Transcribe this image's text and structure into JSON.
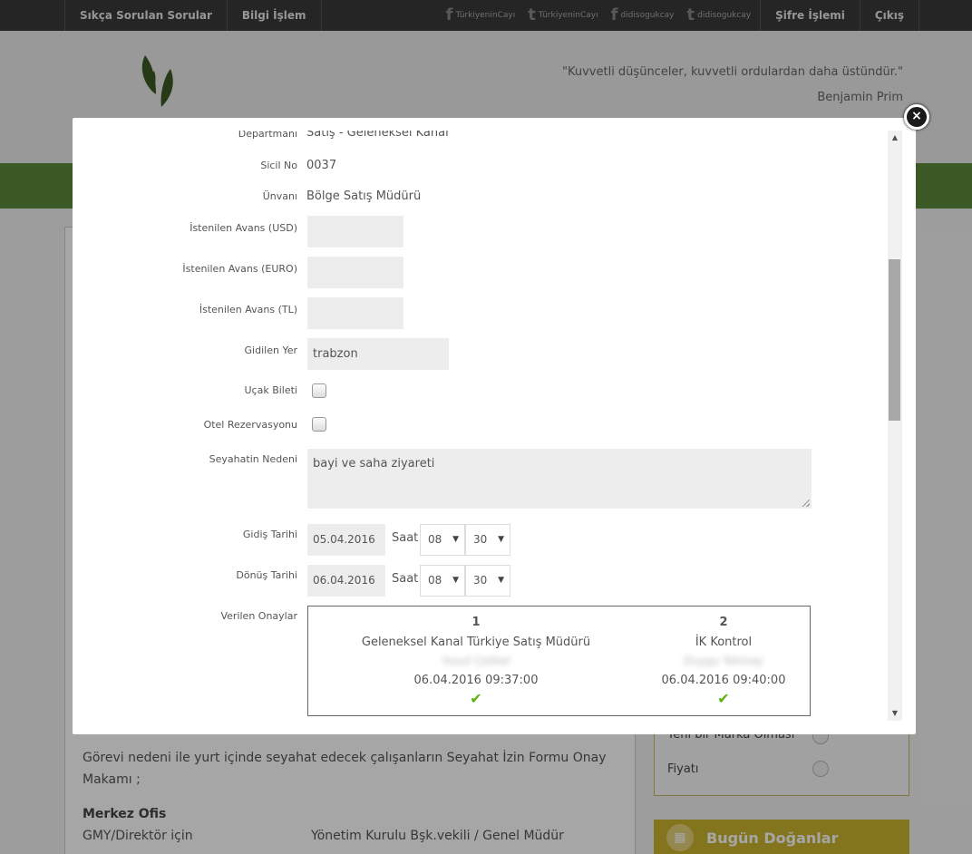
{
  "topbar": {
    "left_items": [
      "Sıkça Sorulan Sorular",
      "Bilgi İşlem"
    ],
    "social": [
      {
        "icon": "facebook-icon",
        "glyph": "f",
        "label": "TürkiyeninCayı"
      },
      {
        "icon": "twitter-icon",
        "glyph": "t",
        "label": "TürkiyeninCayı"
      },
      {
        "icon": "facebook-icon",
        "glyph": "f",
        "label": "didisogukcay"
      },
      {
        "icon": "twitter-icon",
        "glyph": "t",
        "label": "didisogukcay"
      }
    ],
    "right_items": [
      "Şifre İşlemi",
      "Çıkış"
    ]
  },
  "header": {
    "quote": "\"Kuvvetli düşünceler, kuvvetli ordulardan daha üstündür.\"",
    "author": "Benjamin Prim"
  },
  "background": {
    "paragraph": "Görevi nedeni ile yurt içinde seyahat edecek çalışanların Seyahat İzin Formu Onay",
    "paragraph2": "Makamı ;",
    "office_title": "Merkez Ofis",
    "row_left": "GMY/Direktör için",
    "row_right": "Yönetim Kurulu Bşk.vekili / Genel Müdür",
    "side_opt1": "Yeni bir Marka Olması",
    "side_opt2": "Fiyatı",
    "birthday": "Bugün Doğanlar"
  },
  "form": {
    "departman_label": "Departmanı",
    "departman_value": "Satış - Geleneksel Kanal",
    "sicil_label": "Sicil No",
    "sicil_value": "0037",
    "unvan_label": "Ünvanı",
    "unvan_value": "Bölge Satış Müdürü",
    "avans_usd_label": "İstenilen Avans (USD)",
    "avans_usd_value": "",
    "avans_euro_label": "İstenilen Avans (EURO)",
    "avans_euro_value": "",
    "avans_tl_label": "İstenilen Avans (TL)",
    "avans_tl_value": "",
    "gidilen_yer_label": "Gidilen Yer",
    "gidilen_yer_value": "trabzon",
    "ucak_label": "Uçak Bileti",
    "ucak_checked": false,
    "otel_label": "Otel Rezervasyonu",
    "otel_checked": false,
    "neden_label": "Seyahatin Nedeni",
    "neden_value": "bayi ve saha ziyareti",
    "gidis_label": "Gidiş Tarihi",
    "gidis_date": "05.04.2016",
    "gidis_hour": "08",
    "gidis_min": "30",
    "donus_label": "Dönüş Tarihi",
    "donus_date": "06.04.2016",
    "donus_hour": "08",
    "donus_min": "30",
    "saat_label": "Saat",
    "onay_label": "Verilen Onaylar"
  },
  "approvals": [
    {
      "num": "1",
      "title": "Geleneksel Kanal Türkiye Satış Müdürü",
      "name": "Yusuf Çelikel",
      "timestamp": "06.04.2016 09:37:00"
    },
    {
      "num": "2",
      "title": "İK Kontrol",
      "name": "Duygu Tekinay",
      "timestamp": "06.04.2016 09:40:00"
    }
  ],
  "icons": {
    "close": "close-icon",
    "check": "checkmark-icon",
    "scroll_up": "scroll-up-icon",
    "scroll_down": "scroll-down-icon",
    "caret": "chevron-down-icon"
  },
  "glyphs": {
    "close": "×",
    "check": "✔",
    "up": "▲",
    "down": "▼",
    "cake": "▦"
  },
  "colors": {
    "topbar": "#3a3a3a",
    "greenbar": "#5b8a3a",
    "approve_check": "#5cb30f",
    "birthday_banner": "#c9b42e"
  }
}
